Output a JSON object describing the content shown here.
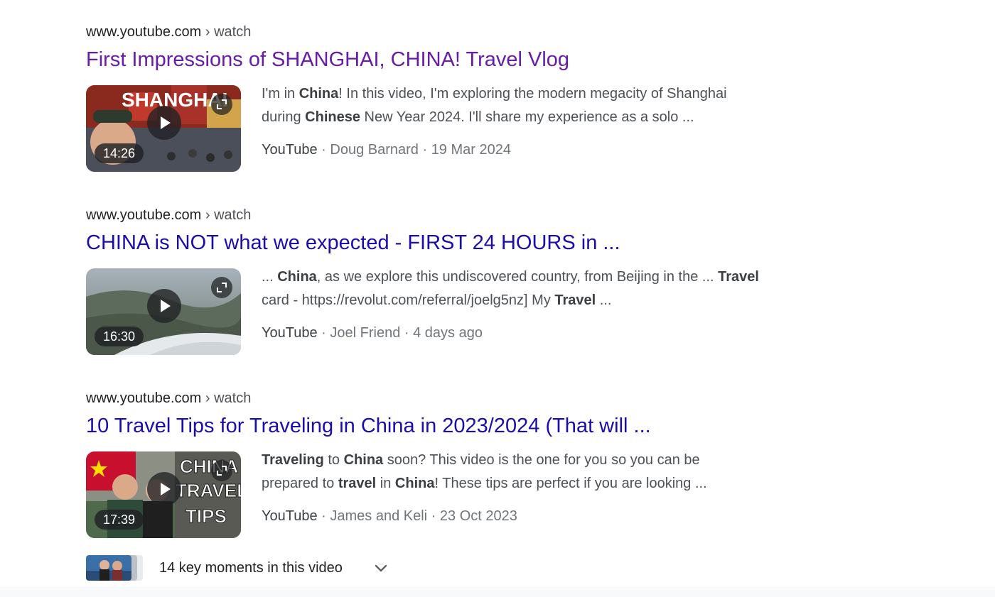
{
  "results": [
    {
      "cite_domain": "www.youtube.com",
      "cite_path": " › watch",
      "title": "First Impressions of SHANGHAI, CHINA! Travel Vlog",
      "thumb_text": "SHANGHAI",
      "duration": "14:26",
      "snippet": [
        {
          "t": "I'm in ",
          "b": false
        },
        {
          "t": "China",
          "b": true
        },
        {
          "t": "! In this video, I'm exploring the modern megacity of Shanghai during ",
          "b": false
        },
        {
          "t": "Chinese",
          "b": true
        },
        {
          "t": " New Year 2024. I'll share my experience as a solo ...",
          "b": false
        }
      ],
      "source": "YouTube",
      "channel": "Doug Barnard",
      "date": "19 Mar 2024"
    },
    {
      "cite_domain": "www.youtube.com",
      "cite_path": " › watch",
      "title": "CHINA is NOT what we expected - FIRST 24 HOURS in ...",
      "thumb_text": "",
      "duration": "16:30",
      "snippet": [
        {
          "t": "... ",
          "b": false
        },
        {
          "t": "China",
          "b": true
        },
        {
          "t": ", as we explore this undiscovered country, from Beijing in the ... ",
          "b": false
        },
        {
          "t": "Travel",
          "b": true
        },
        {
          "t": " card - https://revolut.com/referral/joelg5nz] My ",
          "b": false
        },
        {
          "t": "Travel",
          "b": true
        },
        {
          "t": " ...",
          "b": false
        }
      ],
      "source": "YouTube",
      "channel": "Joel Friend",
      "date": "4 days ago"
    },
    {
      "cite_domain": "www.youtube.com",
      "cite_path": " › watch",
      "title": "10 Travel Tips for Traveling in China in 2023/2024 (That will ...",
      "thumb_text_lines": [
        "CHINA",
        "TRAVEL",
        "TIPS"
      ],
      "duration": "17:39",
      "snippet": [
        {
          "t": "Traveling",
          "b": true
        },
        {
          "t": " to ",
          "b": false
        },
        {
          "t": "China",
          "b": true
        },
        {
          "t": " soon? This video is the one for you so you can be prepared to ",
          "b": false
        },
        {
          "t": "travel",
          "b": true
        },
        {
          "t": " in ",
          "b": false
        },
        {
          "t": "China",
          "b": true
        },
        {
          "t": "! These tips are perfect if you are looking ...",
          "b": false
        }
      ],
      "source": "YouTube",
      "channel": "James and Keli",
      "date": "23 Oct 2023"
    }
  ],
  "key_moments": {
    "label": "14 key moments in this video",
    "icon": "chevron-down-icon"
  },
  "meta_separator": " · ",
  "colors": {
    "link": "#1a0dab",
    "visited_link": "#681da8",
    "snippet": "#4d5156",
    "meta": "#70757a"
  }
}
